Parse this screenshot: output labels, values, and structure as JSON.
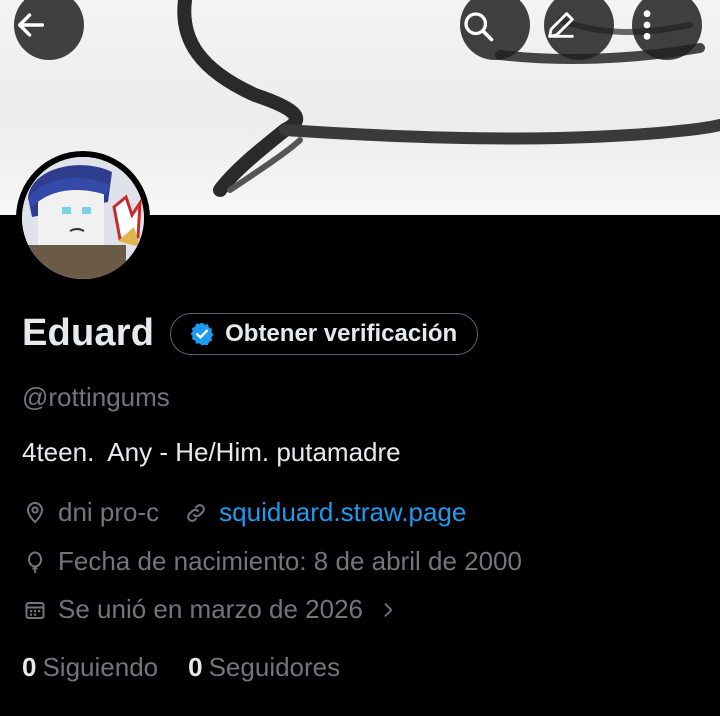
{
  "header": {
    "back_icon": "arrow-left-icon",
    "search_icon": "search-icon",
    "edit_icon": "pencil-icon",
    "more_icon": "more-vertical-icon"
  },
  "profile": {
    "name": "Eduard",
    "verify_label": "Obtener verificación",
    "handle": "@rottingums",
    "bio": "4teen.  Any - He/Him. putamadre",
    "location": "dni pro-c",
    "website": "squiduard.straw.page",
    "birthday": "Fecha de nacimiento: 8 de abril de 2000",
    "joined": "Se unió en marzo de 2026",
    "following_count": "0",
    "following_label": "Siguiendo",
    "followers_count": "0",
    "followers_label": "Seguidores"
  },
  "colors": {
    "background": "#000000",
    "accent": "#1d9bf0",
    "secondary_text": "#71767b",
    "primary_text": "#e7e9ea"
  }
}
